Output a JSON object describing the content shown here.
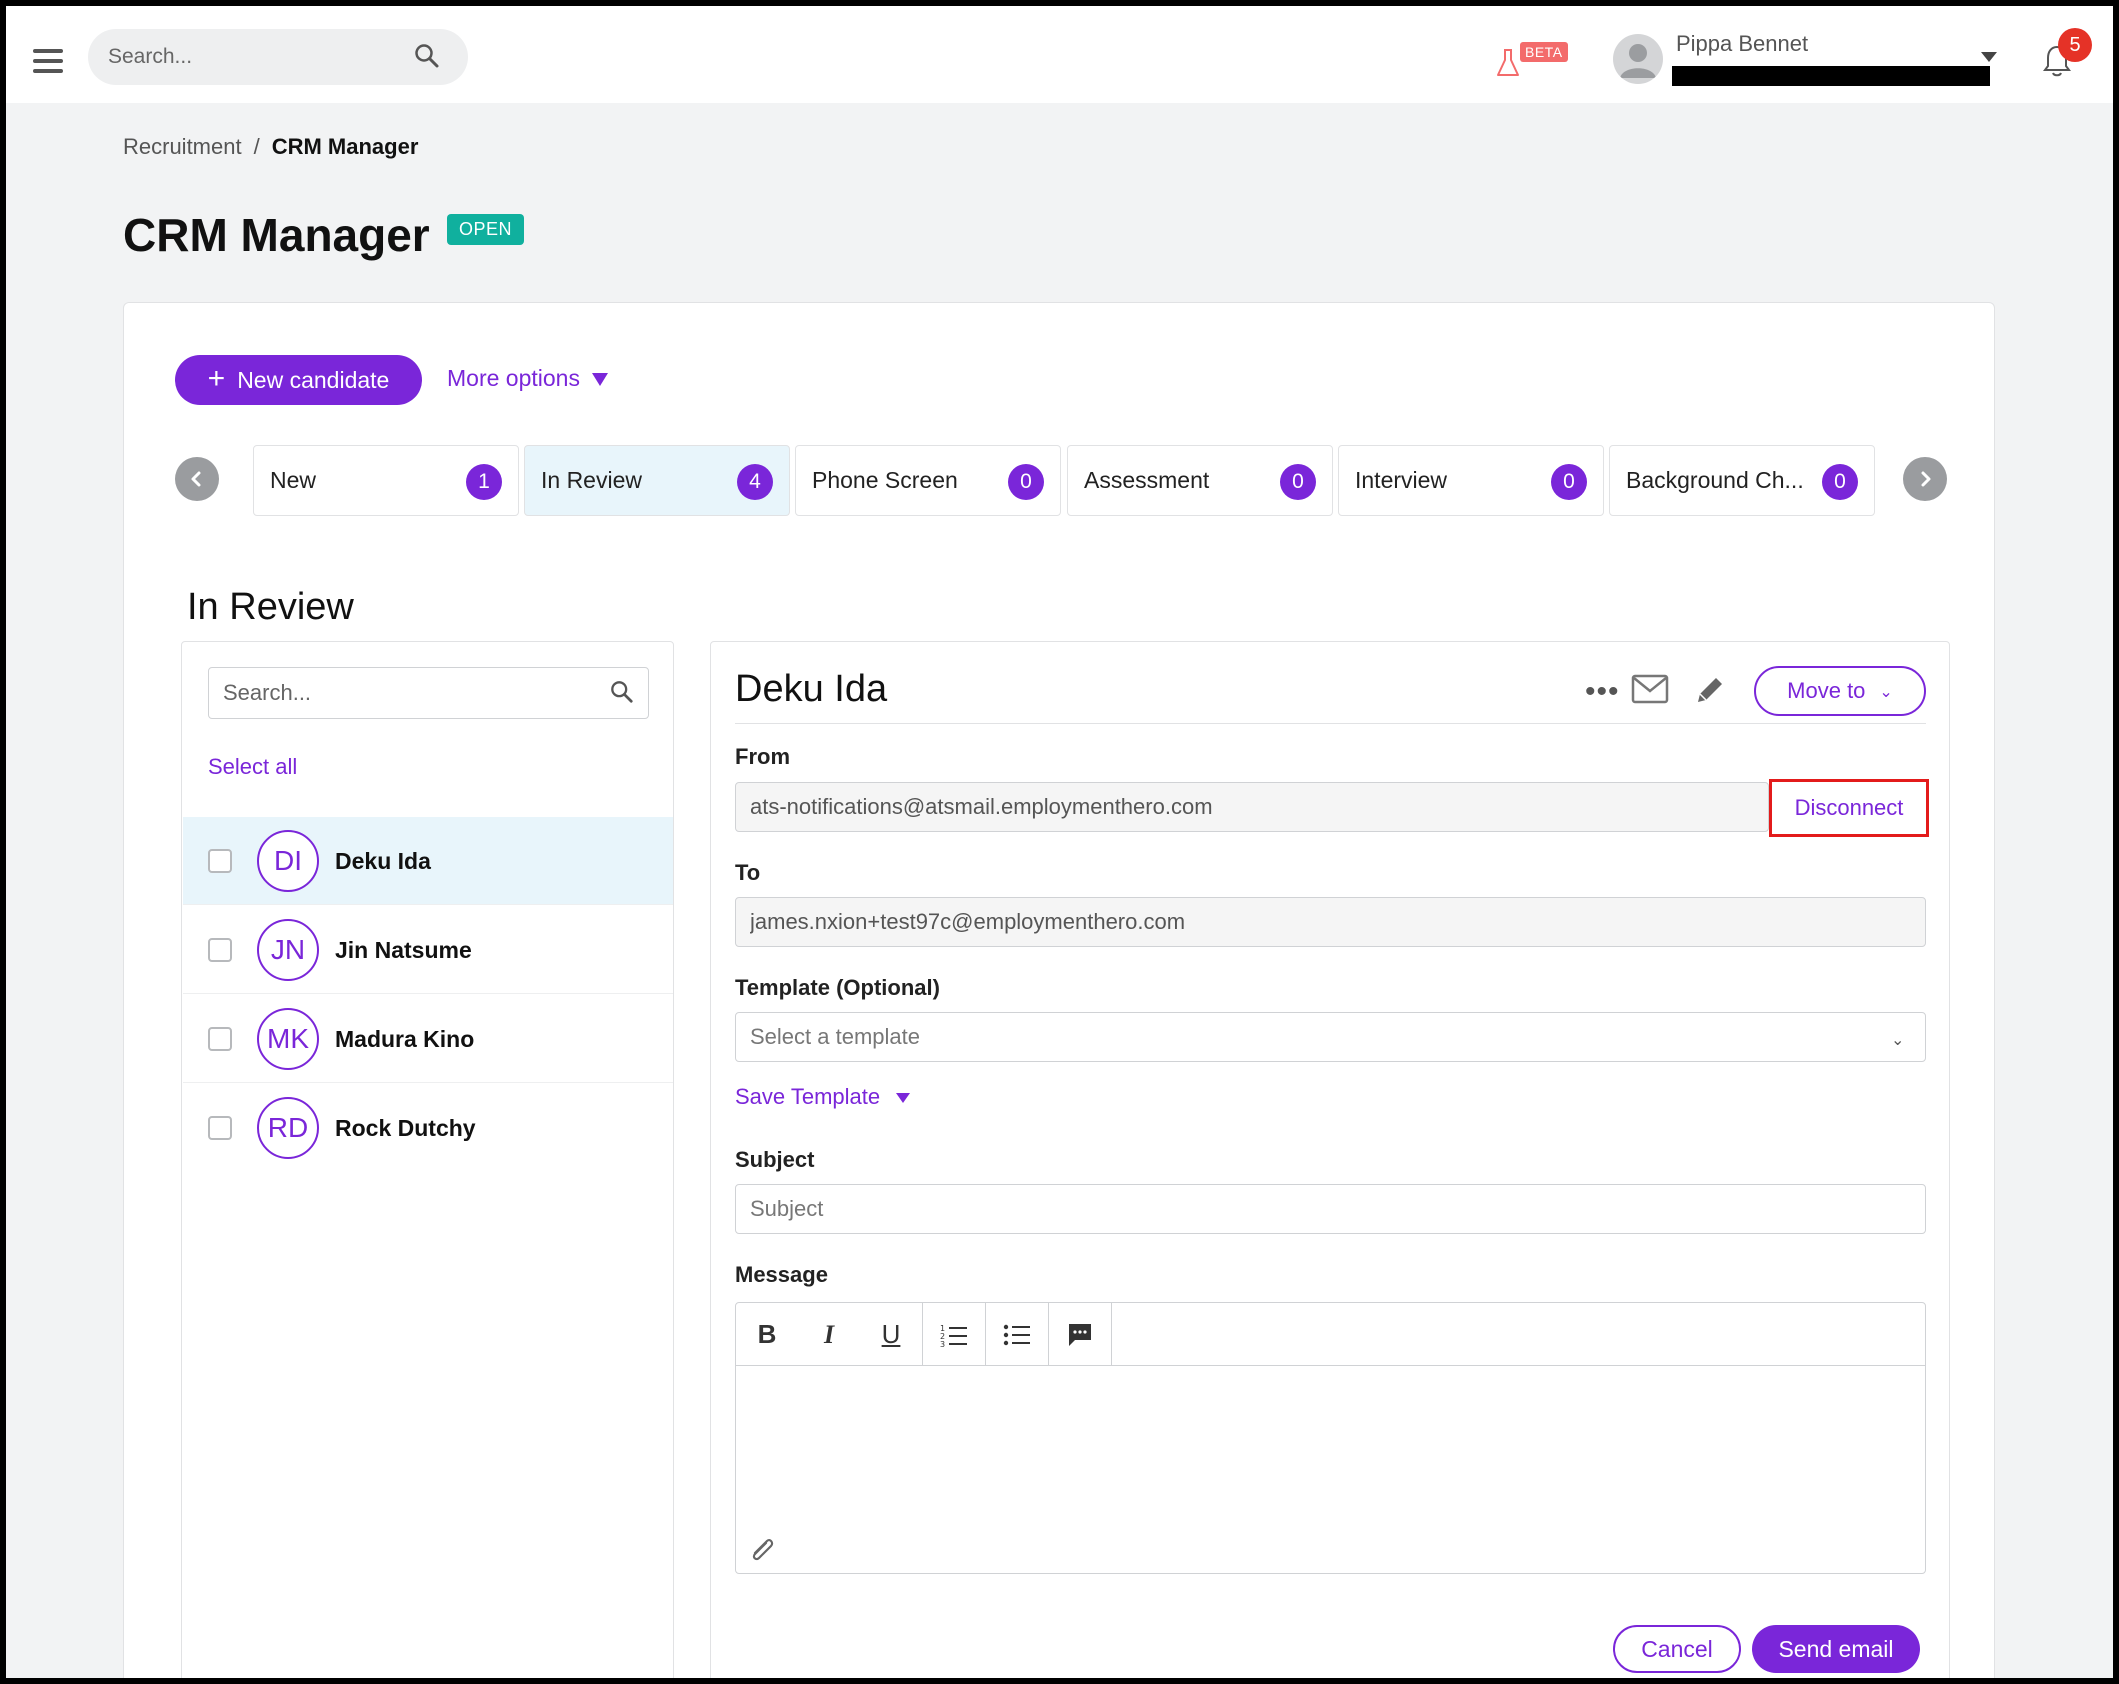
{
  "topbar": {
    "search_placeholder": "Search...",
    "beta_label": "BETA",
    "user_name": "Pippa Bennet",
    "notification_count": "5"
  },
  "breadcrumb": {
    "parent": "Recruitment",
    "separator": "/",
    "current": "CRM Manager"
  },
  "page": {
    "title": "CRM Manager",
    "status": "OPEN"
  },
  "toolbar": {
    "new_candidate_label": "New candidate",
    "more_options_label": "More options"
  },
  "stages": [
    {
      "label": "New",
      "count": "1",
      "active": false
    },
    {
      "label": "In Review",
      "count": "4",
      "active": true
    },
    {
      "label": "Phone Screen",
      "count": "0",
      "active": false
    },
    {
      "label": "Assessment",
      "count": "0",
      "active": false
    },
    {
      "label": "Interview",
      "count": "0",
      "active": false
    },
    {
      "label": "Background Ch...",
      "count": "0",
      "active": false
    }
  ],
  "list": {
    "section_title": "In Review",
    "search_placeholder": "Search...",
    "select_all_label": "Select all",
    "candidates": [
      {
        "initials": "DI",
        "name": "Deku Ida",
        "selected": true
      },
      {
        "initials": "JN",
        "name": "Jin Natsume",
        "selected": false
      },
      {
        "initials": "MK",
        "name": "Madura Kino",
        "selected": false
      },
      {
        "initials": "RD",
        "name": "Rock Dutchy",
        "selected": false
      }
    ]
  },
  "detail": {
    "candidate_name": "Deku Ida",
    "move_to_label": "Move to",
    "from_label": "From",
    "from_value": "ats-notifications@atsmail.employmenthero.com",
    "disconnect_label": "Disconnect",
    "to_label": "To",
    "to_value": "james.nxion+test97c@employmenthero.com",
    "template_label": "Template (Optional)",
    "template_placeholder": "Select a template",
    "save_template_label": "Save Template",
    "subject_label": "Subject",
    "subject_placeholder": "Subject",
    "message_label": "Message",
    "editor_buttons": {
      "bold": "B",
      "italic": "I",
      "underline": "U"
    },
    "cancel_label": "Cancel",
    "send_label": "Send email"
  },
  "colors": {
    "accent": "#7a26d9",
    "status_open": "#10b09e",
    "notification": "#e53227",
    "highlight": "#e31b1b"
  }
}
